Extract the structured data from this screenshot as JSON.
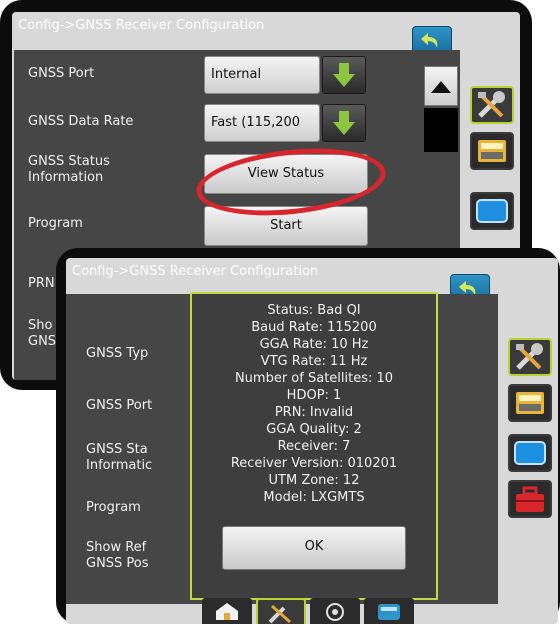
{
  "back_screen": {
    "title": "Config->GNSS Receiver Configuration",
    "rows": [
      {
        "label": "GNSS Port",
        "value": "Internal"
      },
      {
        "label": "GNSS Data Rate",
        "value": "Fast (115,200"
      },
      {
        "label": "GNSS Status\nInformation",
        "button": "View Status"
      },
      {
        "label": "Program",
        "button": "Start"
      },
      {
        "label": "PRN"
      },
      {
        "label": "Sho\nGNS"
      }
    ]
  },
  "front_screen": {
    "title": "Config->GNSS Receiver Configuration",
    "rows": [
      {
        "label": "GNSS Typ"
      },
      {
        "label": "GNSS Port"
      },
      {
        "label": "GNSS Sta\nInformatic"
      },
      {
        "label": "Program"
      },
      {
        "label": "Show Ref\nGNSS Pos"
      }
    ],
    "dialog": {
      "lines": [
        "Status: Bad QI",
        "Baud Rate: 115200",
        "GGA Rate: 10 Hz",
        "VTG Rate: 11 Hz",
        "Number of Satellites: 10",
        "HDOP: 1",
        "PRN: Invalid",
        "GGA Quality: 2",
        "Receiver: 7",
        "Receiver Version: 010201",
        "UTM Zone: 12",
        "Model: LXGMTS"
      ],
      "ok_label": "OK"
    }
  },
  "icons": {
    "back": "back-arrow-icon",
    "tools": "tools-icon",
    "console": "console-icon",
    "display": "display-icon",
    "toolbox": "toolbox-icon",
    "home": "home-icon",
    "gnss": "gnss-icon",
    "data": "data-transfer-icon"
  }
}
